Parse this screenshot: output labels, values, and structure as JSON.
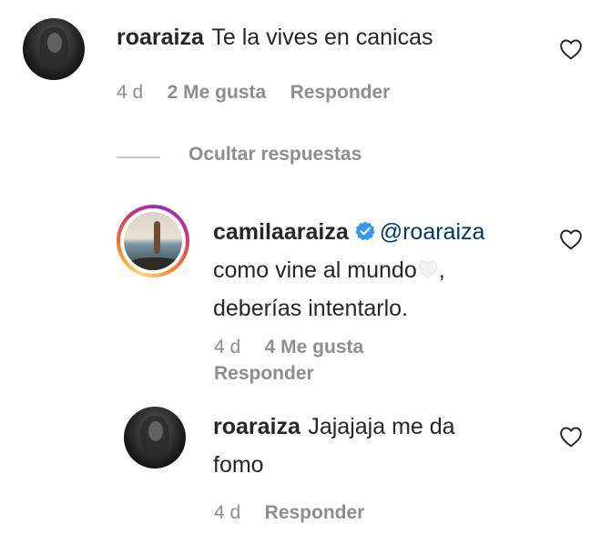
{
  "comments": [
    {
      "username": "roaraiza",
      "text": "Te la vives en canicas",
      "time": "4 d",
      "likes": "2 Me gusta",
      "reply_label": "Responder"
    }
  ],
  "thread_toggle_label": "Ocultar respuestas",
  "replies": [
    {
      "username": "camilaaraiza",
      "mention": "@roaraiza",
      "text_line1": "como vine al mundo",
      "text_line1_end": ",",
      "text_line2": "deberías intentarlo.",
      "time": "4 d",
      "likes": "4 Me gusta",
      "reply_label": "Responder",
      "verified": true
    },
    {
      "username": "roaraiza",
      "text_line1": "Jajajaja me da",
      "text_line2": "fomo",
      "time": "4 d",
      "reply_label": "Responder"
    }
  ],
  "colors": {
    "text": "#262626",
    "meta": "#8e8e8e",
    "mention": "#00376b",
    "verified": "#3897f0"
  },
  "icons": [
    "heart-icon",
    "verified-badge-icon",
    "white-heart-emoji"
  ]
}
